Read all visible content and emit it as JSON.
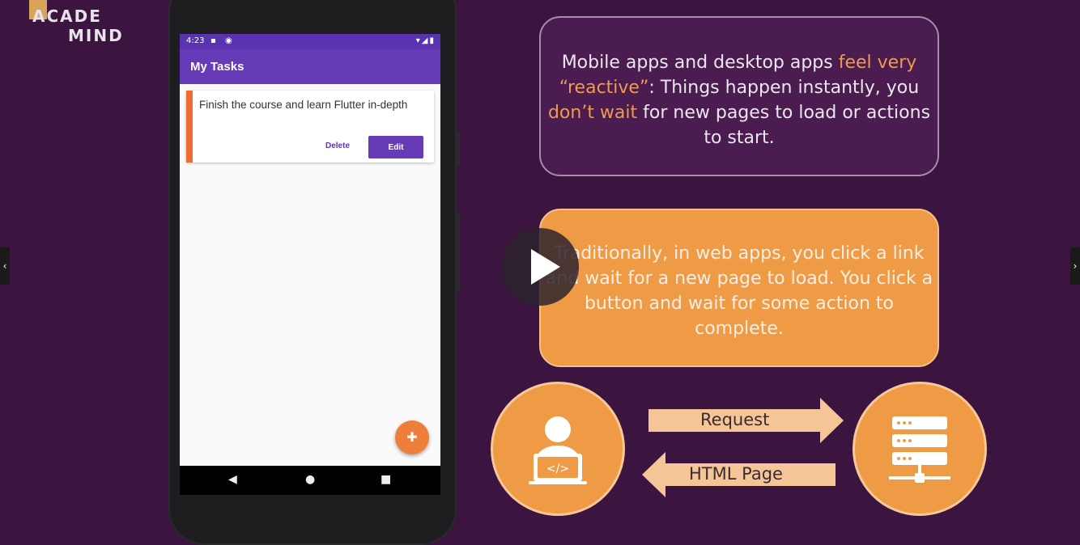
{
  "logo": {
    "line1": "ACADE",
    "line2": "MIND"
  },
  "phone": {
    "status": {
      "time": "4:23"
    },
    "app_title": "My Tasks",
    "task": {
      "text": "Finish the course and learn Flutter in-depth",
      "delete_label": "Delete",
      "edit_label": "Edit"
    },
    "fab_icon": "add-icon"
  },
  "box1": {
    "p1": "Mobile apps and desktop apps ",
    "h1": "feel very “reactive”",
    "p2": ": Things happen instantly, you ",
    "h2": "don’t wait",
    "p3": " for new pages to load or actions to start."
  },
  "box2": {
    "text": "Traditionally, in web apps, you click a link and wait for a new page to load. You click a button and wait for some action to complete."
  },
  "diagram": {
    "request_label": "Request",
    "response_label": "HTML Page"
  },
  "colors": {
    "background": "#3b1440",
    "accent_orange": "#ef9a45",
    "app_purple": "#673ab7"
  }
}
